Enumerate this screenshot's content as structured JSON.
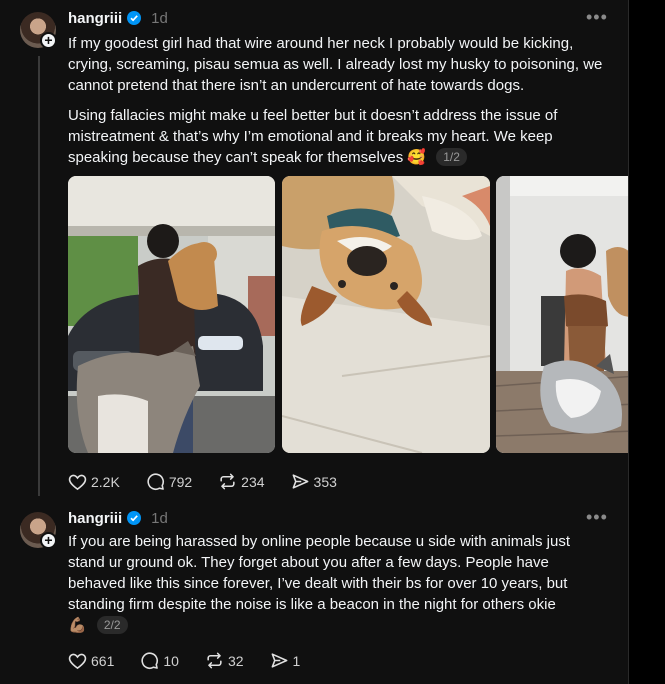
{
  "posts": [
    {
      "username": "hangriii",
      "time": "1d",
      "paragraphs": [
        "If my goodest girl had that wire around her neck I probably would be kicking, crying, screaming, pisau semua as well. I already lost my husky to poisoning, we cannot pretend that there isn’t an undercurrent of hate towards dogs.",
        "Using fallacies might make u feel better but it doesn’t address the issue of mistreatment & that’s why I’m emotional and it breaks my heart. We keep speaking because they can’t speak for themselves"
      ],
      "emoji": "🥰",
      "page_badge": "1/2",
      "stats": {
        "likes": "2.2K",
        "replies": "792",
        "reposts": "234",
        "shares": "353"
      }
    },
    {
      "username": "hangriii",
      "time": "1d",
      "paragraphs": [
        "If you are being harassed by online people because u side with animals just stand ur ground ok. They forget about you after a few days. People have behaved like this since forever, I’ve dealt with their bs for over 10 years, but standing firm despite the noise is like a beacon in the night for others okie"
      ],
      "emoji": "💪🏽",
      "page_badge": "2/2",
      "stats": {
        "likes": "661",
        "replies": "10",
        "reposts": "32",
        "shares": "1"
      }
    }
  ],
  "icons": {
    "more": "more-horizontal-icon",
    "verified": "verified-badge-icon",
    "like": "heart-icon",
    "reply": "comment-icon",
    "repost": "repost-icon",
    "share": "send-icon"
  },
  "colors": {
    "background": "#101010",
    "verified": "#0095f6",
    "muted": "#777777"
  }
}
